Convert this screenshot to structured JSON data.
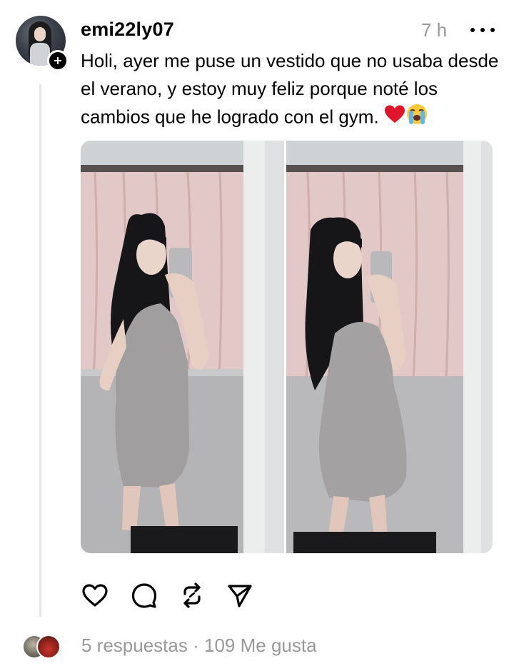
{
  "post": {
    "username": "emi22ly07",
    "time": "7 h",
    "text": "Holi, ayer me puse un vestido que no usaba desde el verano, y estoy muy feliz porque noté los cambios que he logrado con el gym.",
    "emojis": [
      "red-heart-emoji",
      "loudly-crying-face-emoji"
    ]
  },
  "actions": {
    "icons": [
      "heart-icon",
      "comment-icon",
      "repost-icon",
      "share-icon"
    ]
  },
  "footer": {
    "replies": "5 respuestas",
    "separator": "·",
    "likes": "109 Me gusta"
  },
  "colors": {
    "muted_text": "#999999",
    "thread_line": "#e6e6e6",
    "heart_red": "#e0142a"
  }
}
